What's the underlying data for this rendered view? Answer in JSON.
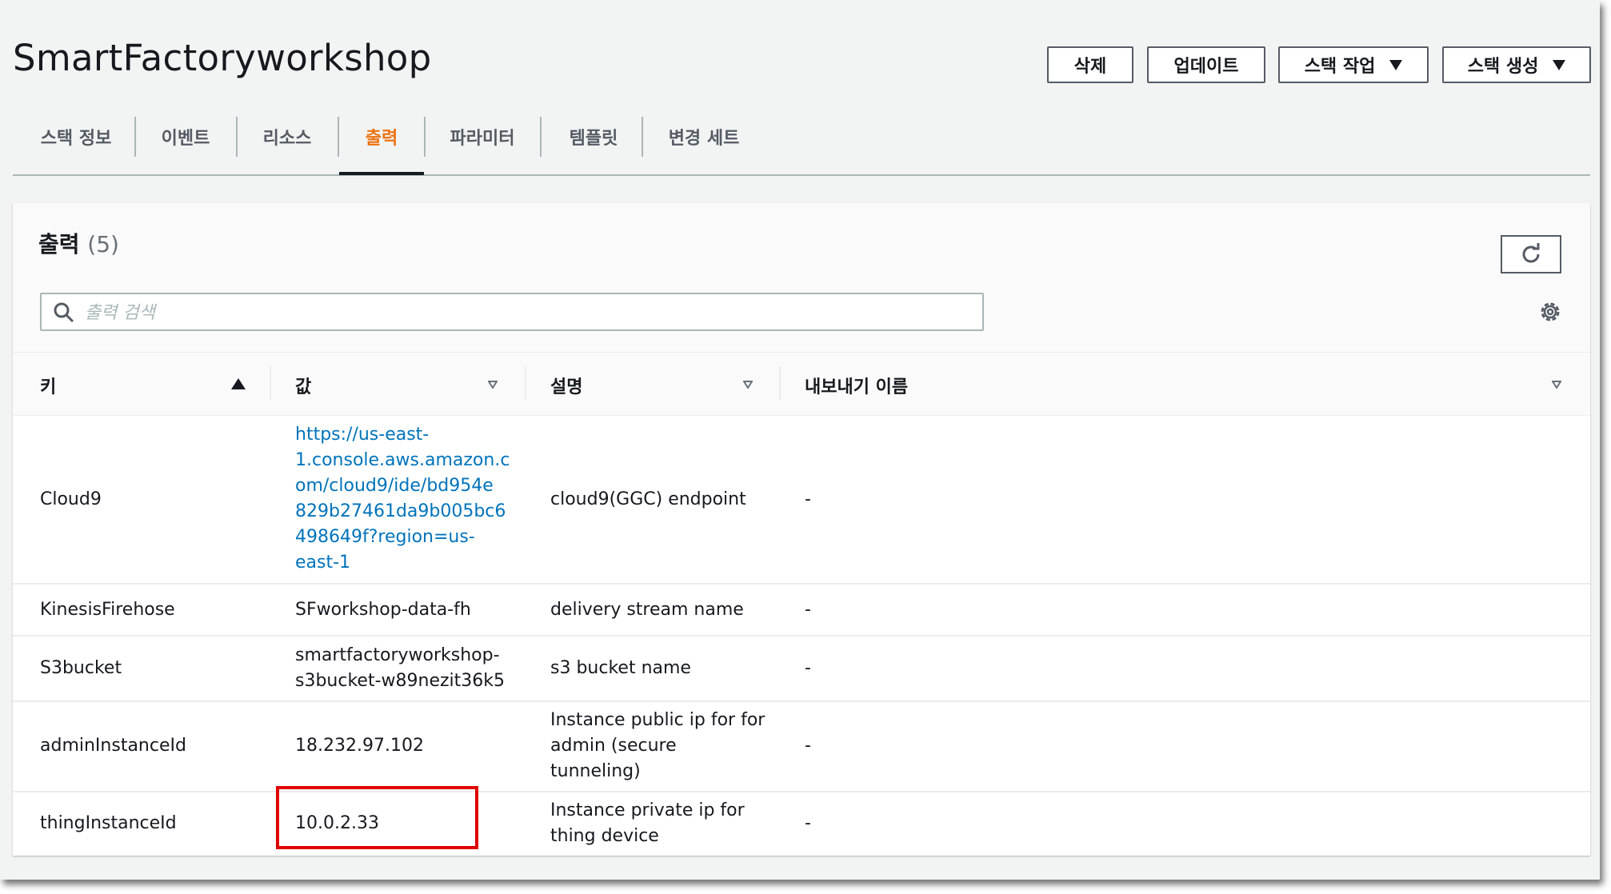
{
  "page": {
    "title": "SmartFactoryworkshop"
  },
  "actions": {
    "delete": "삭제",
    "update": "업데이트",
    "stack_actions": "스택 작업",
    "create_stack": "스택 생성"
  },
  "tabs": [
    {
      "label": "스택 정보"
    },
    {
      "label": "이벤트"
    },
    {
      "label": "리소스"
    },
    {
      "label": "출력",
      "active": true
    },
    {
      "label": "파라미터"
    },
    {
      "label": "템플릿"
    },
    {
      "label": "변경 세트"
    }
  ],
  "outputs": {
    "title": "출력",
    "count": "(5)",
    "search_placeholder": "출력 검색",
    "columns": {
      "key": "키",
      "value": "값",
      "description": "설명",
      "export_name": "내보내기 이름"
    },
    "rows": [
      {
        "key": "Cloud9",
        "value_lines": [
          "https://us-east-",
          "1.console.aws.amazon.c",
          "om/cloud9/ide/bd954e",
          "829b27461da9b005bc6",
          "498649f?region=us-",
          "east-1"
        ],
        "description_lines": [
          "cloud9(GGC) endpoint"
        ],
        "export": "-"
      },
      {
        "key": "KinesisFirehose",
        "value_lines": [
          "SFworkshop-data-fh"
        ],
        "description_lines": [
          "delivery stream name"
        ],
        "export": "-"
      },
      {
        "key": "S3bucket",
        "value_lines": [
          "smartfactoryworkshop-",
          "s3bucket-w89nezit36k5"
        ],
        "description_lines": [
          "s3 bucket name"
        ],
        "export": "-"
      },
      {
        "key": "adminInstanceId",
        "value_lines": [
          "18.232.97.102"
        ],
        "description_lines": [
          "Instance public ip for for",
          "admin (secure",
          "tunneling)"
        ],
        "export": "-"
      },
      {
        "key": "thingInstanceId",
        "value_lines": [
          "10.0.2.33"
        ],
        "description_lines": [
          "Instance private ip for",
          "thing device"
        ],
        "export": "-"
      }
    ]
  },
  "colors": {
    "accent": "#ec7211",
    "link": "#0073bb",
    "highlight": "#e00000"
  }
}
